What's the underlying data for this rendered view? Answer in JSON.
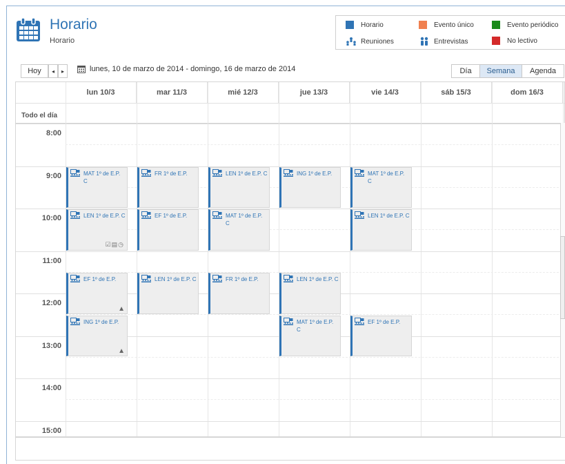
{
  "header": {
    "title": "Horario",
    "subtitle": "Horario"
  },
  "legend": [
    {
      "label": "Horario",
      "type": "swatch",
      "color": "#2f74b5"
    },
    {
      "label": "Evento único",
      "type": "swatch",
      "color": "#f08050"
    },
    {
      "label": "Evento periódico",
      "type": "swatch",
      "color": "#1a8a1a"
    },
    {
      "label": "Reuniones",
      "type": "icon",
      "icon": "people-icon"
    },
    {
      "label": "Entrevistas",
      "type": "icon",
      "icon": "interview-icon"
    },
    {
      "label": "No lectivo",
      "type": "swatch",
      "color": "#d42a2a"
    }
  ],
  "toolbar": {
    "today_label": "Hoy",
    "prev_label": "◂",
    "next_label": "▸",
    "date_range": "lunes, 10 de marzo de 2014 - domingo, 16 de marzo de 2014",
    "views": [
      "Día",
      "Semana",
      "Agenda"
    ],
    "active_view": "Semana"
  },
  "days": [
    "lun 10/3",
    "mar 11/3",
    "mié 12/3",
    "jue 13/3",
    "vie 14/3",
    "sáb 15/3",
    "dom 16/3"
  ],
  "allday_label": "Todo el día",
  "hours": [
    "8:00",
    "9:00",
    "10:00",
    "11:00",
    "12:00",
    "13:00",
    "14:00",
    "15:00"
  ],
  "events": [
    {
      "day": 0,
      "start": 9.0,
      "end": 10.0,
      "title": "MAT 1º de E.P. C"
    },
    {
      "day": 1,
      "start": 9.0,
      "end": 10.0,
      "title": "FR 1º de E.P."
    },
    {
      "day": 2,
      "start": 9.0,
      "end": 10.0,
      "title": "LEN 1º de E.P. C"
    },
    {
      "day": 3,
      "start": 9.0,
      "end": 10.0,
      "title": "ING 1º de E.P."
    },
    {
      "day": 4,
      "start": 9.0,
      "end": 10.0,
      "title": "MAT 1º de E.P. C"
    },
    {
      "day": 0,
      "start": 10.0,
      "end": 11.0,
      "title": "LEN 1º de E.P. C",
      "badge": "tools"
    },
    {
      "day": 1,
      "start": 10.0,
      "end": 11.0,
      "title": "EF 1º de E.P."
    },
    {
      "day": 2,
      "start": 10.0,
      "end": 11.0,
      "title": "MAT 1º de E.P. C"
    },
    {
      "day": 4,
      "start": 10.0,
      "end": 11.0,
      "title": "LEN 1º de E.P. C"
    },
    {
      "day": 0,
      "start": 11.5,
      "end": 12.5,
      "title": "EF 1º de E.P.",
      "badge": "warn"
    },
    {
      "day": 1,
      "start": 11.5,
      "end": 12.5,
      "title": "LEN 1º de E.P. C"
    },
    {
      "day": 2,
      "start": 11.5,
      "end": 12.5,
      "title": "FR 1º de E.P."
    },
    {
      "day": 3,
      "start": 11.5,
      "end": 12.5,
      "title": "LEN 1º de E.P. C"
    },
    {
      "day": 0,
      "start": 12.5,
      "end": 13.5,
      "title": "ING 1º de E.P.",
      "badge": "warn"
    },
    {
      "day": 3,
      "start": 12.5,
      "end": 13.5,
      "title": "MAT 1º de E.P. C"
    },
    {
      "day": 4,
      "start": 12.5,
      "end": 13.5,
      "title": "EF 1º de E.P."
    }
  ]
}
